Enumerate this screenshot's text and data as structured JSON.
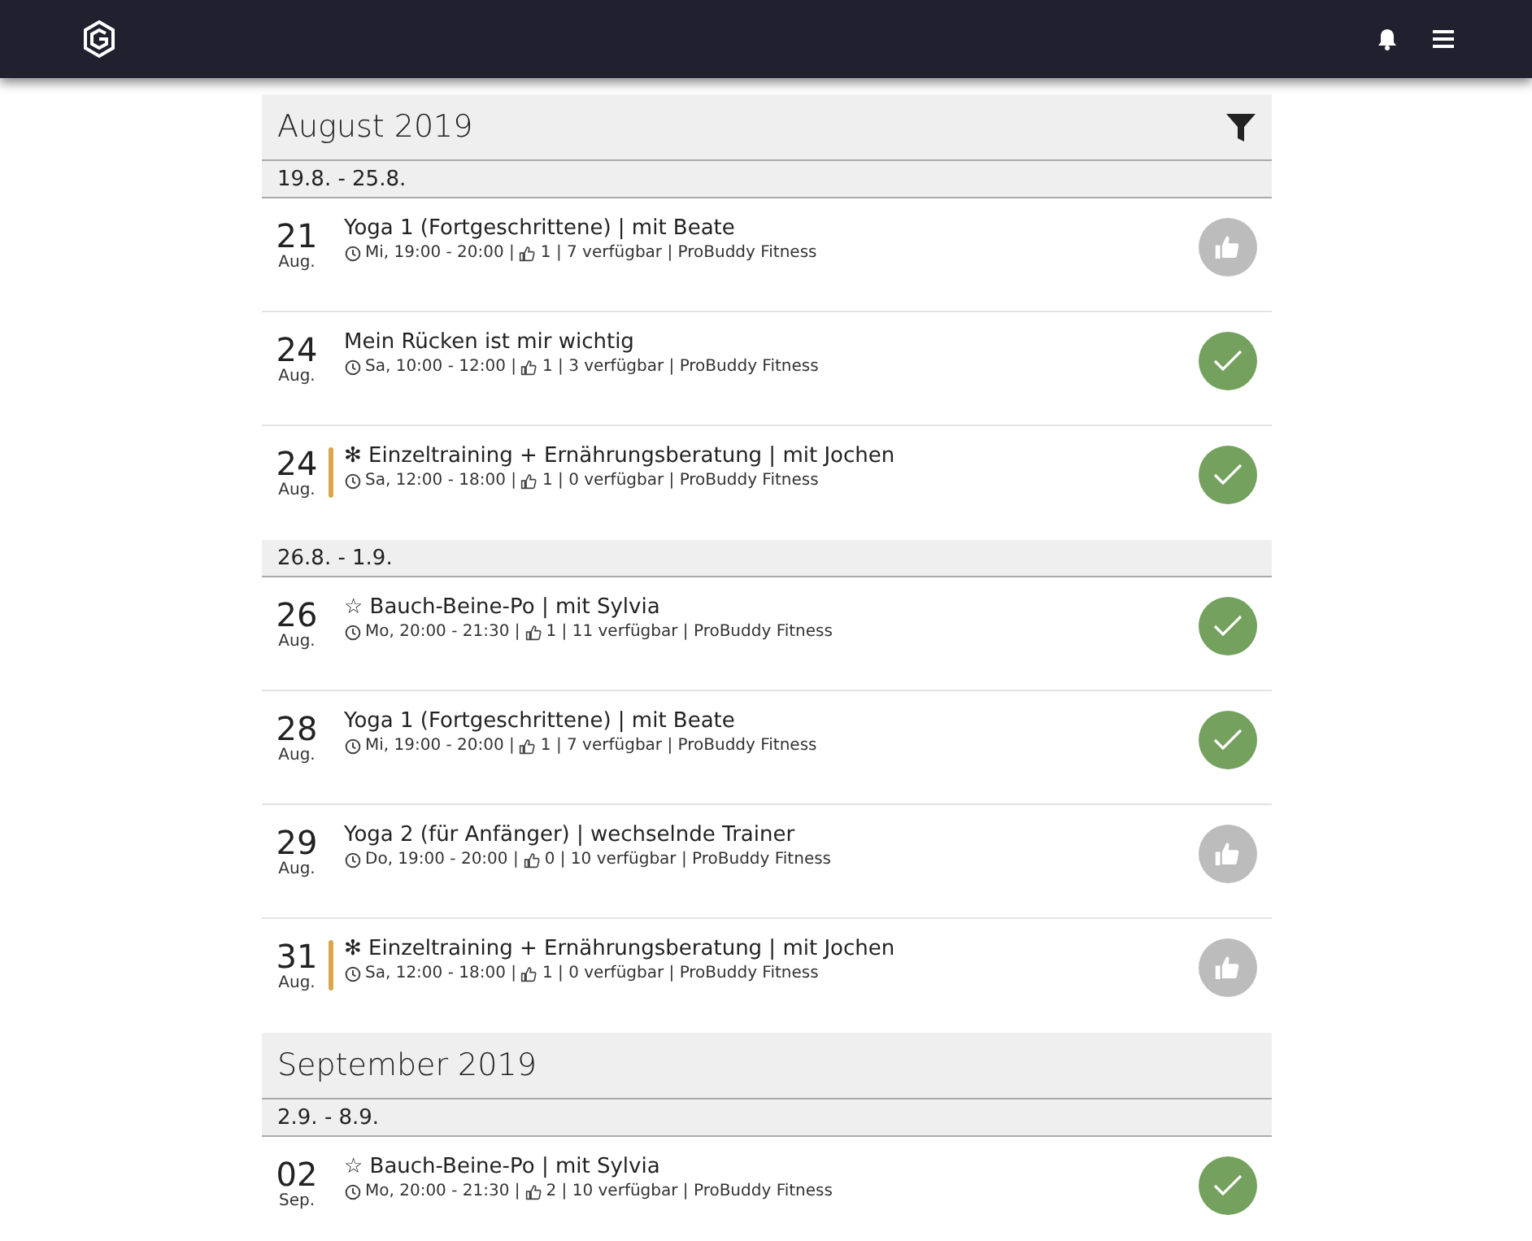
{
  "months": [
    {
      "title": "August 2019",
      "filter": true,
      "weeks": [
        {
          "range": "19.8. - 25.8.",
          "events": [
            {
              "day": "21",
              "month": "Aug.",
              "flagged": false,
              "title": "Yoga 1 (Fortgeschrittene) | mit Beate",
              "time": "Mi, 19:00 - 20:00 |",
              "info": "1 | 7 verfügbar | ProBuddy Fitness",
              "kind": "like"
            },
            {
              "day": "24",
              "month": "Aug.",
              "flagged": false,
              "title": "Mein Rücken ist mir wichtig",
              "time": "Sa, 10:00 - 12:00 |",
              "info": "1 | 3 verfügbar | ProBuddy Fitness",
              "kind": "booked"
            },
            {
              "day": "24",
              "month": "Aug.",
              "flagged": true,
              "title": "✻ Einzeltraining + Ernährungsberatung | mit Jochen",
              "time": "Sa, 12:00 - 18:00 |",
              "info": "1 | 0 verfügbar | ProBuddy Fitness",
              "kind": "booked"
            }
          ]
        },
        {
          "range": "26.8. - 1.9.",
          "events": [
            {
              "day": "26",
              "month": "Aug.",
              "flagged": false,
              "title": "☆ Bauch-Beine-Po | mit Sylvia",
              "time": "Mo, 20:00 - 21:30 |",
              "info": "1 | 11 verfügbar | ProBuddy Fitness",
              "kind": "booked"
            },
            {
              "day": "28",
              "month": "Aug.",
              "flagged": false,
              "title": "Yoga 1 (Fortgeschrittene) | mit Beate",
              "time": "Mi, 19:00 - 20:00 |",
              "info": "1 | 7 verfügbar | ProBuddy Fitness",
              "kind": "booked"
            },
            {
              "day": "29",
              "month": "Aug.",
              "flagged": false,
              "title": "Yoga 2 (für Anfänger) | wechselnde Trainer",
              "time": "Do, 19:00 - 20:00 |",
              "info": "0 | 10 verfügbar | ProBuddy Fitness",
              "kind": "like"
            },
            {
              "day": "31",
              "month": "Aug.",
              "flagged": true,
              "title": "✻ Einzeltraining + Ernährungsberatung | mit Jochen",
              "time": "Sa, 12:00 - 18:00 |",
              "info": "1 | 0 verfügbar | ProBuddy Fitness",
              "kind": "like"
            }
          ]
        }
      ]
    },
    {
      "title": "September 2019",
      "filter": false,
      "weeks": [
        {
          "range": "2.9. - 8.9.",
          "events": [
            {
              "day": "02",
              "month": "Sep.",
              "flagged": false,
              "title": "☆ Bauch-Beine-Po | mit Sylvia",
              "time": "Mo, 20:00 - 21:30 |",
              "info": "2 | 10 verfügbar | ProBuddy Fitness",
              "kind": "booked"
            }
          ]
        }
      ]
    }
  ]
}
